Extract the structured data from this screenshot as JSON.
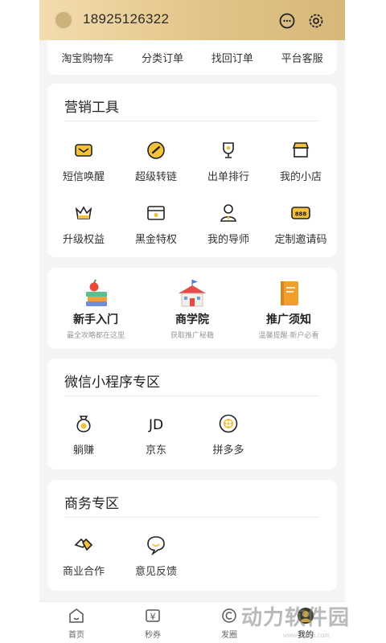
{
  "header": {
    "phone": "18925126322",
    "icons": [
      "chat-icon",
      "gear-icon"
    ]
  },
  "quick_links": [
    "淘宝购物车",
    "分类订单",
    "找回订单",
    "平台客服"
  ],
  "marketing": {
    "title": "营销工具",
    "items": [
      {
        "label": "短信唤醒",
        "icon": "sms-icon"
      },
      {
        "label": "超级转链",
        "icon": "link-icon"
      },
      {
        "label": "出单排行",
        "icon": "trophy-icon"
      },
      {
        "label": "我的小店",
        "icon": "shop-icon"
      },
      {
        "label": "升级权益",
        "icon": "crown-icon"
      },
      {
        "label": "黑金特权",
        "icon": "card-icon"
      },
      {
        "label": "我的导师",
        "icon": "mentor-icon"
      },
      {
        "label": "定制邀请码",
        "icon": "invite-code-icon"
      }
    ]
  },
  "promos": [
    {
      "title": "新手入门",
      "subtitle": "最全攻略都在这里",
      "icon": "books-apple-icon"
    },
    {
      "title": "商学院",
      "subtitle": "获取推广秘籍",
      "icon": "school-icon"
    },
    {
      "title": "推广须知",
      "subtitle": "温馨提醒·新户必看",
      "icon": "notebook-icon"
    }
  ],
  "wechat": {
    "title": "微信小程序专区",
    "items": [
      {
        "label": "躺赚",
        "icon": "money-bag-icon"
      },
      {
        "label": "京东",
        "icon": "jd-icon",
        "glyph": "JD"
      },
      {
        "label": "拼多多",
        "icon": "pinduoduo-icon"
      }
    ]
  },
  "business": {
    "title": "商务专区",
    "items": [
      {
        "label": "商业合作",
        "icon": "handshake-icon"
      },
      {
        "label": "意见反馈",
        "icon": "feedback-icon"
      }
    ]
  },
  "tabs": [
    {
      "label": "首页",
      "icon": "home-icon"
    },
    {
      "label": "秒券",
      "icon": "coupon-icon",
      "glyph": "¥"
    },
    {
      "label": "发圈",
      "icon": "share-icon"
    },
    {
      "label": "我的",
      "icon": "profile-icon",
      "active": true
    }
  ],
  "watermark": {
    "text": "动力软件园",
    "sub": "www.dongli.com"
  },
  "colors": {
    "accent": "#e8b33a",
    "header_start": "#f3dcae",
    "header_end": "#d7b77a",
    "background": "#f4f4f4"
  }
}
